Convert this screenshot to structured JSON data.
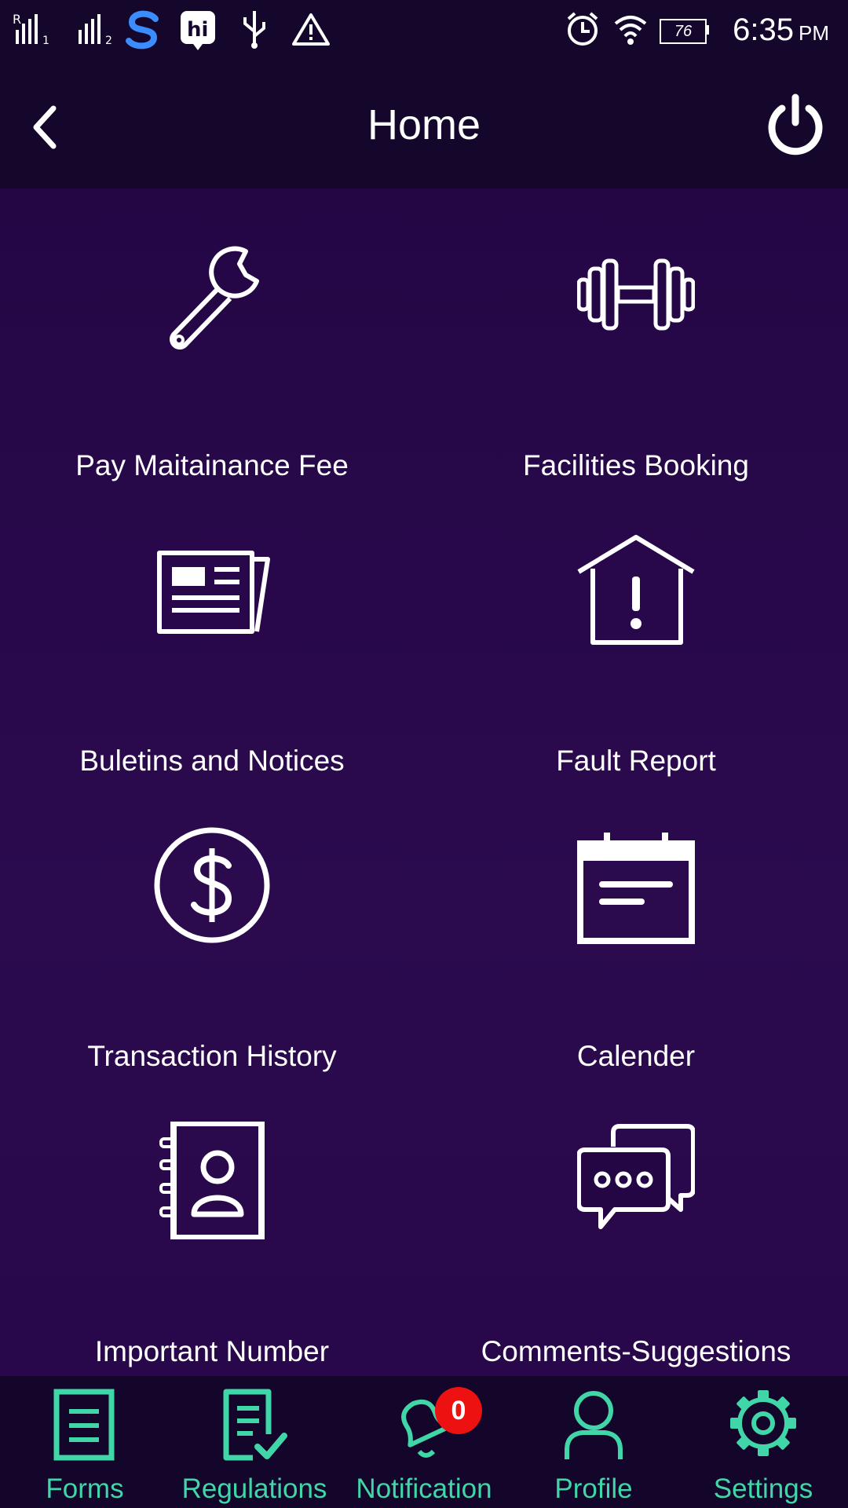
{
  "status_bar": {
    "battery": "76",
    "time": "6:35",
    "ampm": "PM"
  },
  "header": {
    "title": "Home"
  },
  "tiles": [
    {
      "label": "Pay Maitainance Fee",
      "icon": "wrench-icon"
    },
    {
      "label": "Facilities Booking",
      "icon": "dumbbell-icon"
    },
    {
      "label": "Buletins and Notices",
      "icon": "newspaper-icon"
    },
    {
      "label": "Fault Report",
      "icon": "house-alert-icon"
    },
    {
      "label": "Transaction History",
      "icon": "dollar-circle-icon"
    },
    {
      "label": "Calender",
      "icon": "calendar-icon"
    },
    {
      "label": "Important Number",
      "icon": "contact-book-icon"
    },
    {
      "label": "Comments-Suggestions",
      "icon": "chat-bubbles-icon"
    }
  ],
  "bottom_nav": {
    "items": [
      {
        "label": "Forms",
        "icon": "form-icon"
      },
      {
        "label": "Regulations",
        "icon": "regulations-icon"
      },
      {
        "label": "Notification",
        "icon": "bell-icon",
        "badge": "0"
      },
      {
        "label": "Profile",
        "icon": "profile-icon"
      },
      {
        "label": "Settings",
        "icon": "gear-icon"
      }
    ]
  },
  "colors": {
    "background": "#240645",
    "header": "#15062c",
    "nav_accent": "#40d6a8",
    "badge": "#ee1111"
  }
}
